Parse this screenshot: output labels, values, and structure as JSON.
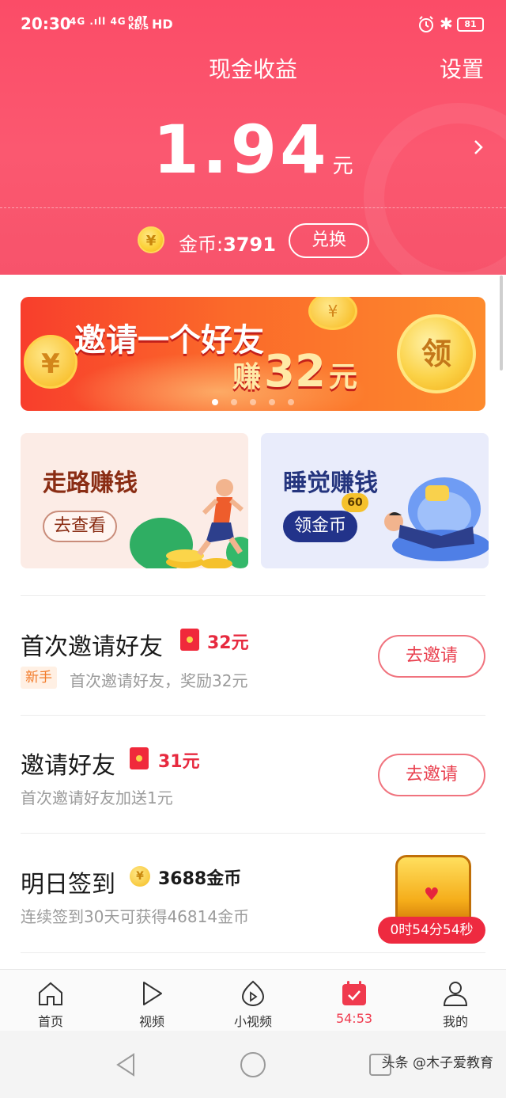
{
  "status_bar": {
    "time": "20:30",
    "signal": "4G .ıll 4G .ıll",
    "net_speed_value": "0.07",
    "net_speed_unit": "KB/S",
    "hd": "HD",
    "battery": "81"
  },
  "header": {
    "title": "现金收益",
    "settings_label": "设置",
    "balance": "1.94",
    "balance_unit": "元",
    "coin_label": "金币:",
    "coin_value": "3791",
    "exchange_label": "兑换"
  },
  "banner": {
    "title": "邀请一个好友",
    "earn": "赚",
    "amount": "32",
    "unit": "元",
    "claim": "领",
    "coin_symbol": "¥",
    "dots": 5,
    "active_dot": 0
  },
  "cards": {
    "walk": {
      "title": "走路赚钱",
      "button": "去查看"
    },
    "sleep": {
      "title": "睡觉赚钱",
      "button": "领金币",
      "badge": "60"
    }
  },
  "tasks": [
    {
      "title": "首次邀请好友",
      "reward": "32元",
      "tag": "新手",
      "desc": "首次邀请好友，奖励32元",
      "button": "去邀请"
    },
    {
      "title": "邀请好友",
      "reward": "31元",
      "desc": "首次邀请好友加送1元",
      "button": "去邀请"
    },
    {
      "title": "明日签到",
      "reward": "3688金币",
      "desc": "连续签到30天可获得46814金币",
      "countdown": "0时54分54秒"
    }
  ],
  "bottom_nav": [
    {
      "label": "首页",
      "icon": "home-icon"
    },
    {
      "label": "视频",
      "icon": "play-icon"
    },
    {
      "label": "小视频",
      "icon": "short-video-icon"
    },
    {
      "label": "54:53",
      "icon": "calendar-check-icon",
      "active": true
    },
    {
      "label": "我的",
      "icon": "person-icon"
    }
  ],
  "watermark": "头条 @木子爱教育",
  "colors": {
    "header": "#fb4c67",
    "accent_red": "#e72a3f",
    "coin_gold": "#fcd23a",
    "walk_card": "#fcece6",
    "sleep_card": "#e9ecfb"
  }
}
